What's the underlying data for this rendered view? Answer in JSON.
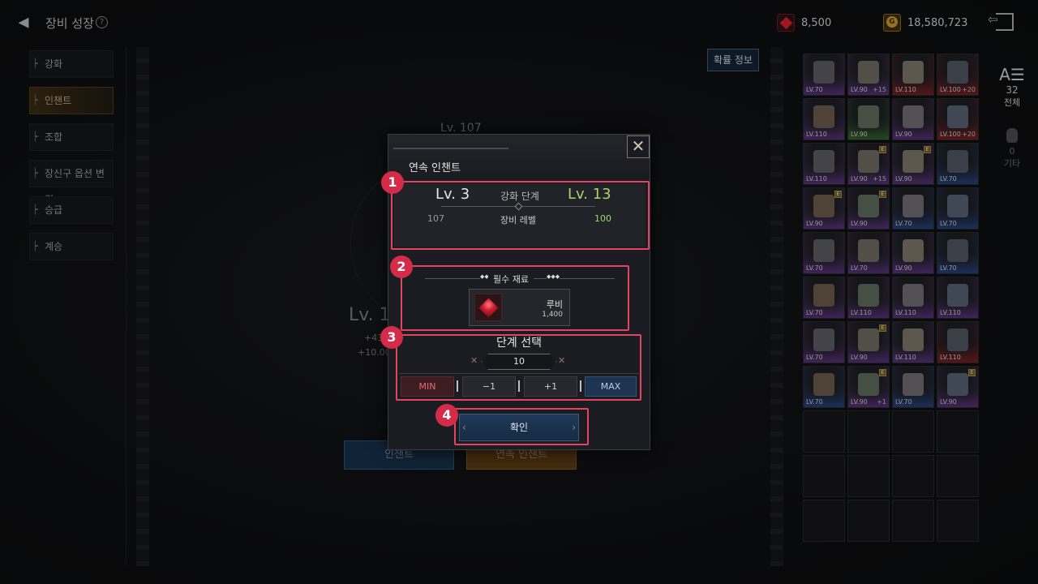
{
  "header": {
    "title": "장비 성장",
    "help_icon": "?",
    "ruby_amount": "8,500",
    "gold_amount": "18,580,723"
  },
  "sidebar": {
    "items": [
      {
        "label": "강화"
      },
      {
        "label": "인챈트"
      },
      {
        "label": "조합"
      },
      {
        "label": "장신구 옵션 변경"
      },
      {
        "label": "승급"
      },
      {
        "label": "계승"
      }
    ]
  },
  "background": {
    "prob_button": "확률 정보",
    "level_top": "Lv. 107",
    "level_big": "Lv. 1",
    "stat1": "+43",
    "stat2": "+10.00",
    "enchant_button": "인챈트",
    "continuous_button": "연속 인챈트"
  },
  "inventory": {
    "filter_all_count": "32",
    "filter_all_label": "전체",
    "filter_etc_count": "0",
    "filter_etc_label": "기타",
    "slots": [
      {
        "lv": "LV.70",
        "plus": "",
        "badge": false,
        "rarity": "purple"
      },
      {
        "lv": "LV.90",
        "plus": "+15",
        "badge": false,
        "rarity": "purple"
      },
      {
        "lv": "LV.110",
        "plus": "",
        "badge": false,
        "rarity": "red"
      },
      {
        "lv": "LV.100",
        "plus": "+20",
        "badge": false,
        "rarity": "red"
      },
      {
        "lv": "LV.110",
        "plus": "",
        "badge": false,
        "rarity": "purple"
      },
      {
        "lv": "LV.90",
        "plus": "",
        "badge": false,
        "rarity": "green"
      },
      {
        "lv": "LV.90",
        "plus": "",
        "badge": false,
        "rarity": "purple"
      },
      {
        "lv": "LV.100",
        "plus": "+20",
        "badge": false,
        "rarity": "red"
      },
      {
        "lv": "LV.110",
        "plus": "",
        "badge": false,
        "rarity": "purple"
      },
      {
        "lv": "LV.90",
        "plus": "+15",
        "badge": true,
        "rarity": "purple"
      },
      {
        "lv": "LV.90",
        "plus": "",
        "badge": true,
        "rarity": "purple"
      },
      {
        "lv": "LV.70",
        "plus": "",
        "badge": false,
        "rarity": "blue"
      },
      {
        "lv": "LV.90",
        "plus": "",
        "badge": true,
        "rarity": "purple"
      },
      {
        "lv": "LV.90",
        "plus": "",
        "badge": true,
        "rarity": "purple"
      },
      {
        "lv": "LV.70",
        "plus": "",
        "badge": false,
        "rarity": "blue"
      },
      {
        "lv": "LV.70",
        "plus": "",
        "badge": false,
        "rarity": "blue"
      },
      {
        "lv": "LV.70",
        "plus": "",
        "badge": false,
        "rarity": "purple"
      },
      {
        "lv": "LV.70",
        "plus": "",
        "badge": false,
        "rarity": "purple"
      },
      {
        "lv": "LV.90",
        "plus": "",
        "badge": false,
        "rarity": "purple"
      },
      {
        "lv": "LV.70",
        "plus": "",
        "badge": false,
        "rarity": "blue"
      },
      {
        "lv": "LV.70",
        "plus": "",
        "badge": false,
        "rarity": "purple"
      },
      {
        "lv": "LV.110",
        "plus": "",
        "badge": false,
        "rarity": "purple"
      },
      {
        "lv": "LV.110",
        "plus": "",
        "badge": false,
        "rarity": "purple"
      },
      {
        "lv": "LV.110",
        "plus": "",
        "badge": false,
        "rarity": "purple"
      },
      {
        "lv": "LV.70",
        "plus": "",
        "badge": false,
        "rarity": "purple"
      },
      {
        "lv": "LV.90",
        "plus": "",
        "badge": true,
        "rarity": "purple"
      },
      {
        "lv": "LV.110",
        "plus": "",
        "badge": false,
        "rarity": "purple"
      },
      {
        "lv": "LV.110",
        "plus": "",
        "badge": false,
        "rarity": "red"
      },
      {
        "lv": "LV.70",
        "plus": "",
        "badge": false,
        "rarity": "blue"
      },
      {
        "lv": "LV.90",
        "plus": "+1",
        "badge": true,
        "rarity": "purple"
      },
      {
        "lv": "LV.70",
        "plus": "",
        "badge": false,
        "rarity": "blue"
      },
      {
        "lv": "LV.90",
        "plus": "",
        "badge": true,
        "rarity": "purple"
      }
    ]
  },
  "modal": {
    "title": "연속 인챈트",
    "close_icon": "✕",
    "stage": {
      "from": "Lv. 3",
      "label": "강화 단계",
      "to": "Lv. 13"
    },
    "gear": {
      "from": "107",
      "label": "장비 레벨",
      "to": "100"
    },
    "required_title": "필수 재료",
    "material": {
      "name": "루비",
      "qty": "1,400"
    },
    "step_title": "단계 선택",
    "step_value": "10",
    "buttons": {
      "min": "MIN",
      "minus": "−1",
      "plus": "+1",
      "max": "MAX"
    },
    "confirm": "확인"
  },
  "annotations": [
    "1",
    "2",
    "3",
    "4"
  ]
}
